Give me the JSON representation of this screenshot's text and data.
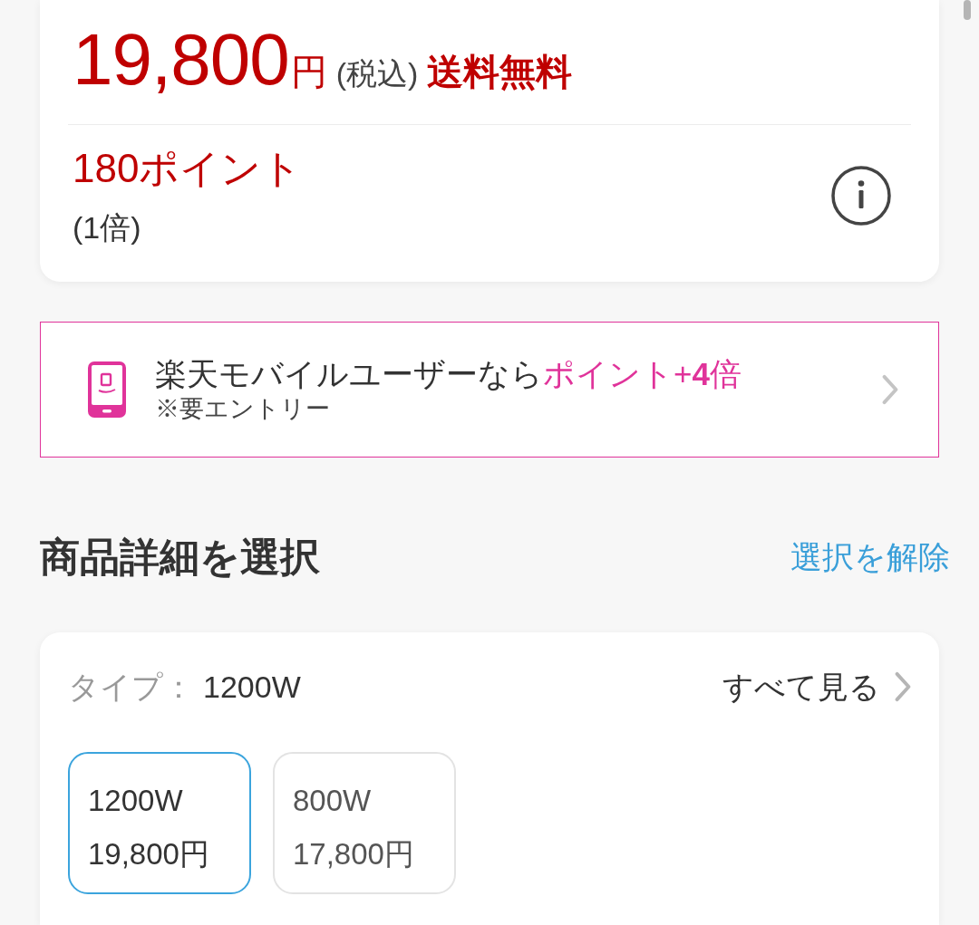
{
  "price": {
    "amount": "19,800",
    "currency": "円",
    "tax_note": "(税込)",
    "shipping": "送料無料"
  },
  "points": {
    "amount": "180ポイント",
    "multiplier": "(1倍)"
  },
  "mobile_banner": {
    "text": "楽天モバイルユーザーなら",
    "highlight": "ポイント+**4**倍",
    "note": "※要エントリー"
  },
  "section": {
    "title": "商品詳細を選択",
    "clear_link": "選択を解除"
  },
  "selector": {
    "label": "タイプ：",
    "value": "1200W",
    "see_all": "すべて見る",
    "options": [
      {
        "name": "1200W",
        "price": "19,800円",
        "selected": true
      },
      {
        "name": "800W",
        "price": "17,800円",
        "selected": false
      }
    ]
  }
}
